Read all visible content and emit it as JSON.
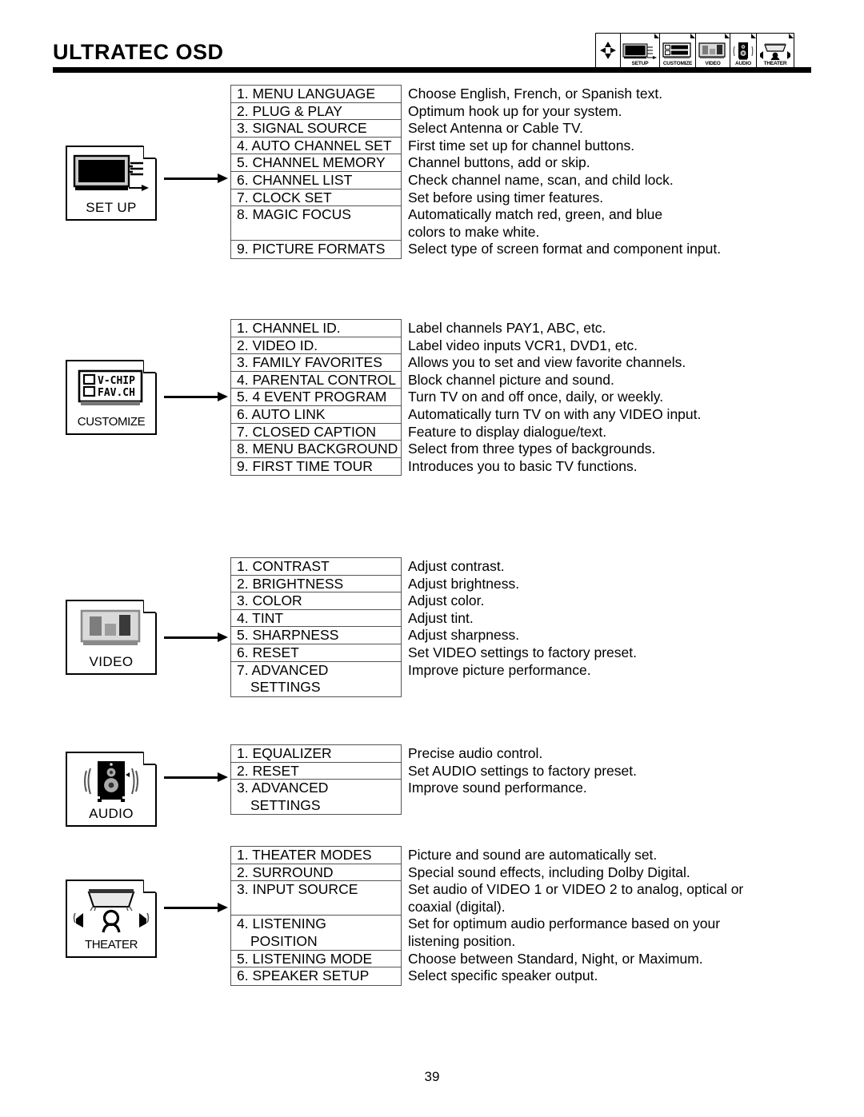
{
  "header": {
    "title": "ULTRATEC OSD",
    "page_number": "39"
  },
  "iconbar": {
    "nav_icon": "four-way-arrow-icon",
    "tabs": [
      {
        "label": "SETUP",
        "icon": "tv-with-plug-icon"
      },
      {
        "label": "CUSTOMIZE",
        "icon": "vchip-favch-screen-icon"
      },
      {
        "label": "VIDEO",
        "icon": "picture-bars-screen-icon"
      },
      {
        "label": "AUDIO",
        "icon": "speaker-icon"
      },
      {
        "label": "THEATER",
        "icon": "home-theater-icon"
      }
    ]
  },
  "sections": [
    {
      "id": "setup",
      "icon_label": "SET UP",
      "icon_name": "tv-with-plug-icon",
      "items": [
        {
          "label": "1. MENU LANGUAGE"
        },
        {
          "label": "2. PLUG & PLAY"
        },
        {
          "label": "3. SIGNAL SOURCE"
        },
        {
          "label": "4. AUTO CHANNEL SET"
        },
        {
          "label": "5. CHANNEL MEMORY"
        },
        {
          "label": "6. CHANNEL LIST"
        },
        {
          "label": "7. CLOCK SET"
        },
        {
          "label": "8. MAGIC FOCUS"
        },
        {
          "label": "9. PICTURE FORMATS"
        }
      ],
      "descriptions": [
        "Choose English, French, or Spanish text.",
        "Optimum hook up for your system.",
        "Select Antenna or Cable TV.",
        "First time set up for channel buttons.",
        "Channel buttons, add or skip.",
        "Check channel name, scan, and child lock.",
        "Set before using timer features.",
        "Automatically match red, green, and blue",
        "colors to make white.",
        "Select  type of screen format and component input."
      ]
    },
    {
      "id": "customize",
      "icon_label": "CUSTOMIZE",
      "icon_name": "vchip-favch-screen-icon",
      "icon_lines": [
        "V-CHIP",
        "FAV.CH"
      ],
      "items": [
        {
          "label": "1. CHANNEL ID."
        },
        {
          "label": "2. VIDEO ID."
        },
        {
          "label": "3. FAMILY FAVORITES"
        },
        {
          "label": "4. PARENTAL CONTROL"
        },
        {
          "label": "5. 4 EVENT PROGRAM"
        },
        {
          "label": "6. AUTO LINK"
        },
        {
          "label": "7. CLOSED CAPTION"
        },
        {
          "label": "8. MENU BACKGROUND"
        },
        {
          "label": "9. FIRST TIME TOUR"
        }
      ],
      "descriptions": [
        "Label channels PAY1, ABC, etc.",
        "Label video inputs VCR1, DVD1, etc.",
        "Allows you to set and view favorite channels.",
        "Block channel picture and sound.",
        "Turn TV on and off once, daily, or weekly.",
        "Automatically turn TV on with any VIDEO input.",
        "Feature to display dialogue/text.",
        "Select from three types of backgrounds.",
        "Introduces you to basic TV functions."
      ]
    },
    {
      "id": "video",
      "icon_label": "VIDEO",
      "icon_name": "picture-bars-screen-icon",
      "items": [
        {
          "label": "1. CONTRAST"
        },
        {
          "label": "2. BRIGHTNESS"
        },
        {
          "label": "3. COLOR"
        },
        {
          "label": "4. TINT"
        },
        {
          "label": "5. SHARPNESS"
        },
        {
          "label": "6. RESET"
        },
        {
          "label": "7. ADVANCED",
          "label2": "SETTINGS"
        }
      ],
      "descriptions": [
        "Adjust contrast.",
        "Adjust brightness.",
        "Adjust color.",
        "Adjust tint.",
        "Adjust sharpness.",
        "Set VIDEO settings to factory preset.",
        "Improve picture performance."
      ]
    },
    {
      "id": "audio",
      "icon_label": "AUDIO",
      "icon_name": "speaker-icon",
      "items": [
        {
          "label": "1. EQUALIZER"
        },
        {
          "label": "2. RESET"
        },
        {
          "label": "3. ADVANCED",
          "label2": "SETTINGS"
        }
      ],
      "descriptions": [
        "Precise audio control.",
        "Set AUDIO settings to factory preset.",
        "Improve sound performance."
      ]
    },
    {
      "id": "theater",
      "icon_label": "THEATER",
      "icon_name": "home-theater-icon",
      "items": [
        {
          "label": "1. THEATER MODES"
        },
        {
          "label": "2. SURROUND"
        },
        {
          "label": "3. INPUT SOURCE"
        },
        {
          "label": "4. LISTENING",
          "label2": "POSITION"
        },
        {
          "label": "5. LISTENING MODE"
        },
        {
          "label": "6. SPEAKER SETUP"
        }
      ],
      "descriptions": [
        "Picture and sound are automatically set.",
        "Special sound effects, including Dolby Digital.",
        "Set audio of VIDEO 1 or VIDEO 2 to analog, optical or",
        "coaxial (digital).",
        "Set for optimum audio performance based on your",
        "listening position.",
        "Choose between Standard, Night, or Maximum.",
        "Select specific speaker output."
      ]
    }
  ]
}
